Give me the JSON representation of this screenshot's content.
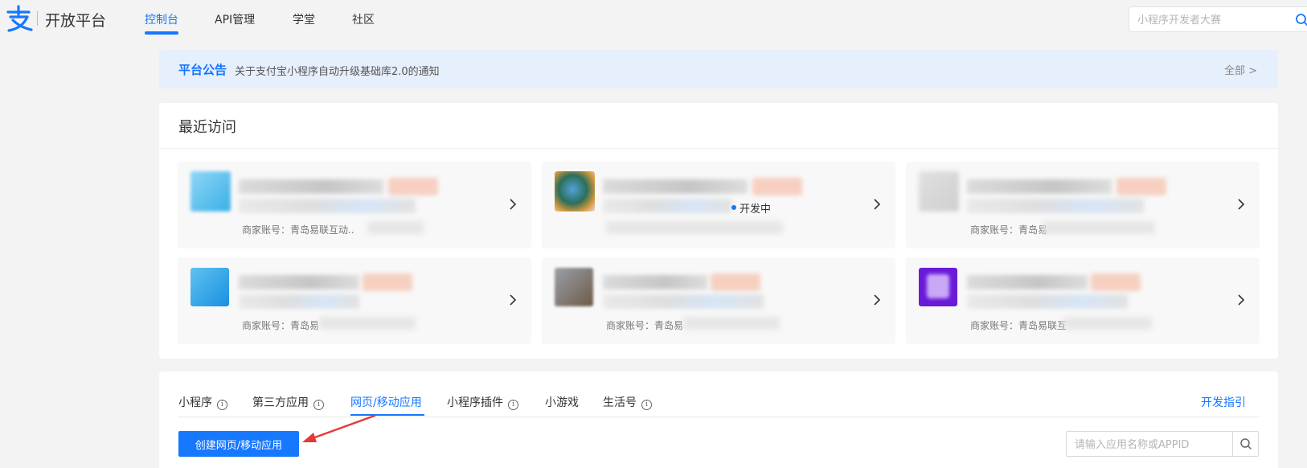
{
  "header": {
    "brand_text": "开放平台",
    "nav": [
      {
        "label": "控制台",
        "active": true
      },
      {
        "label": "API管理",
        "active": false
      },
      {
        "label": "学堂",
        "active": false
      },
      {
        "label": "社区",
        "active": false
      }
    ],
    "search_placeholder": "小程序开发者大赛"
  },
  "notice": {
    "title": "平台公告",
    "text": "关于支付宝小程序自动升级基础库2.0的通知",
    "all_label": "全部 >"
  },
  "recent": {
    "title": "最近访问",
    "cards": [
      {
        "merchant": "商家账号：青岛易联互动..",
        "status": ""
      },
      {
        "merchant": "",
        "status": "开发中"
      },
      {
        "merchant": "商家账号：青岛易",
        "status": ""
      },
      {
        "merchant": "商家账号：青岛易",
        "status": ""
      },
      {
        "merchant": "商家账号：青岛易",
        "status": ""
      },
      {
        "merchant": "商家账号：青岛易联互",
        "status": ""
      }
    ]
  },
  "apps": {
    "tabs": [
      {
        "label": "小程序",
        "info": true,
        "active": false
      },
      {
        "label": "第三方应用",
        "info": true,
        "active": false
      },
      {
        "label": "网页/移动应用",
        "info": false,
        "active": true
      },
      {
        "label": "小程序插件",
        "info": true,
        "active": false
      },
      {
        "label": "小游戏",
        "info": false,
        "active": false
      },
      {
        "label": "生活号",
        "info": true,
        "active": false
      }
    ],
    "dev_guide": "开发指引",
    "create_button": "创建网页/移动应用",
    "search_placeholder": "请输入应用名称或APPID"
  },
  "colors": {
    "accent": "#1677ff",
    "notice_bg": "#e6effc",
    "page_bg": "#f3f3f3",
    "annotation_arrow": "#e53935"
  },
  "icons": [
    "alipay-logo-icon",
    "search-icon",
    "chevron-right-icon",
    "info-icon",
    "red-arrow-annotation"
  ]
}
